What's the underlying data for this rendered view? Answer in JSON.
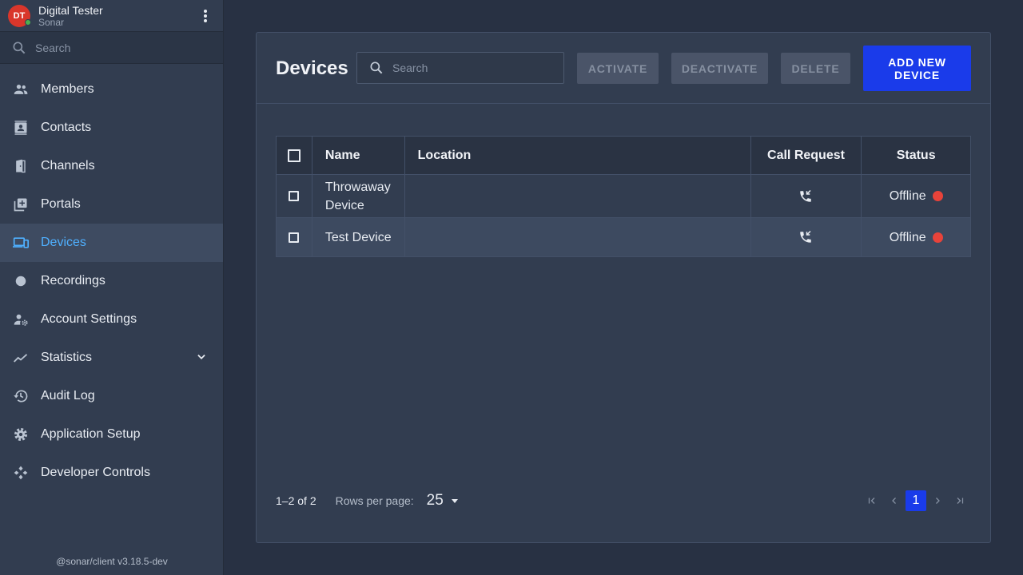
{
  "user": {
    "initials": "DT",
    "name": "Digital Tester",
    "org": "Sonar"
  },
  "sidebar": {
    "search_placeholder": "Search",
    "items": [
      {
        "label": "Members",
        "icon": "people-icon"
      },
      {
        "label": "Contacts",
        "icon": "contact-card-icon"
      },
      {
        "label": "Channels",
        "icon": "door-icon"
      },
      {
        "label": "Portals",
        "icon": "add-box-icon"
      },
      {
        "label": "Devices",
        "icon": "devices-icon",
        "active": true
      },
      {
        "label": "Recordings",
        "icon": "record-circle-icon"
      },
      {
        "label": "Account Settings",
        "icon": "person-gear-icon"
      },
      {
        "label": "Statistics",
        "icon": "trending-line-icon",
        "expandable": true
      },
      {
        "label": "Audit Log",
        "icon": "history-icon"
      },
      {
        "label": "Application Setup",
        "icon": "gear-icon"
      },
      {
        "label": "Developer Controls",
        "icon": "developer-icon"
      }
    ],
    "version": "@sonar/client v3.18.5-dev"
  },
  "page": {
    "title": "Devices",
    "search_placeholder": "Search",
    "buttons": {
      "activate": "ACTIVATE",
      "deactivate": "DEACTIVATE",
      "delete": "DELETE",
      "add": "ADD NEW DEVICE"
    }
  },
  "table": {
    "columns": {
      "name": "Name",
      "location": "Location",
      "call": "Call Request",
      "status": "Status"
    },
    "rows": [
      {
        "name": "Throwaway Device",
        "location": "",
        "status": "Offline"
      },
      {
        "name": "Test Device",
        "location": "",
        "status": "Offline"
      }
    ]
  },
  "pagination": {
    "range": "1–2 of 2",
    "rows_label": "Rows per page:",
    "rows_value": "25",
    "current_page": "1"
  },
  "colors": {
    "accent": "#1a3bea",
    "active_nav": "#4fb0ff",
    "offline": "#e8433a",
    "online": "#4caf50"
  }
}
